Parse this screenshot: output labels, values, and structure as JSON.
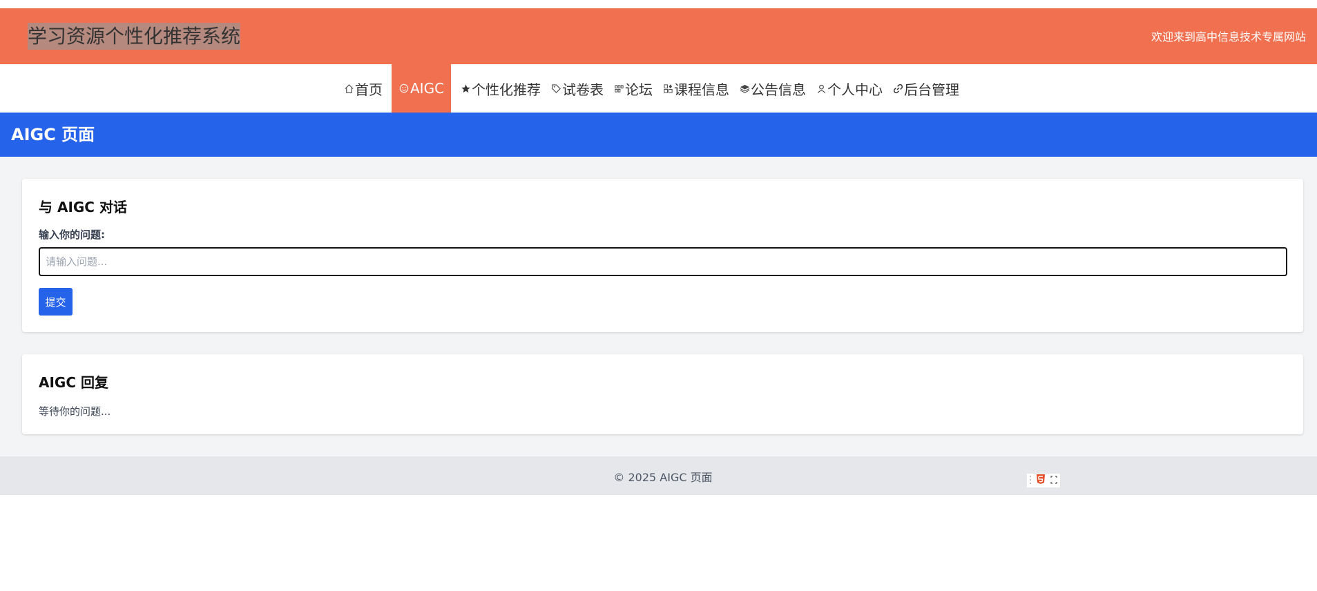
{
  "header": {
    "site_title": "学习资源个性化推荐系统",
    "welcome": "欢迎来到高中信息技术专属网站",
    "brand_color": "#f07050"
  },
  "nav": {
    "items": [
      {
        "label": "首页",
        "icon": "home-icon"
      },
      {
        "label": "AIGC",
        "icon": "smile-icon",
        "active": true
      },
      {
        "label": "个性化推荐",
        "icon": "star-icon"
      },
      {
        "label": "试卷表",
        "icon": "tag-icon"
      },
      {
        "label": "论坛",
        "icon": "grid-icon"
      },
      {
        "label": "课程信息",
        "icon": "apps-icon"
      },
      {
        "label": "公告信息",
        "icon": "layers-icon"
      },
      {
        "label": "个人中心",
        "icon": "user-icon"
      },
      {
        "label": "后台管理",
        "icon": "link-icon"
      }
    ]
  },
  "page_header": {
    "title": "AIGC 页面",
    "color": "#2563eb"
  },
  "ask_card": {
    "title": "与 AIGC 对话",
    "field_label": "输入你的问题:",
    "input_value": "",
    "input_placeholder": "请输入问题...",
    "submit_label": "提交"
  },
  "reply_card": {
    "title": "AIGC 回复",
    "text": "等待你的问题..."
  },
  "footer": {
    "text": "© 2025 AIGC 页面"
  }
}
